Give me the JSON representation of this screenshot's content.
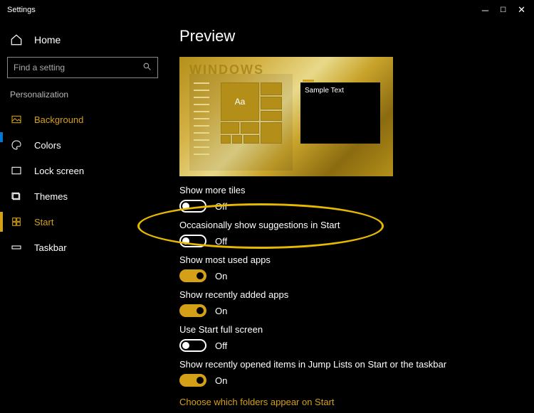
{
  "window": {
    "title": "Settings"
  },
  "sidebar": {
    "home": "Home",
    "search_placeholder": "Find a setting",
    "section": "Personalization",
    "items": [
      {
        "label": "Background"
      },
      {
        "label": "Colors"
      },
      {
        "label": "Lock screen"
      },
      {
        "label": "Themes"
      },
      {
        "label": "Start"
      },
      {
        "label": "Taskbar"
      }
    ]
  },
  "main": {
    "title": "Preview",
    "preview_sample": "Sample Text",
    "preview_tile_aa": "Aa",
    "preview_watermark": "WINDOWS",
    "settings": [
      {
        "label": "Show more tiles",
        "state": "Off",
        "on": false
      },
      {
        "label": "Occasionally show suggestions in Start",
        "state": "Off",
        "on": false
      },
      {
        "label": "Show most used apps",
        "state": "On",
        "on": true
      },
      {
        "label": "Show recently added apps",
        "state": "On",
        "on": true
      },
      {
        "label": "Use Start full screen",
        "state": "Off",
        "on": false
      },
      {
        "label": "Show recently opened items in Jump Lists on Start or the taskbar",
        "state": "On",
        "on": true
      }
    ],
    "link": "Choose which folders appear on Start"
  }
}
